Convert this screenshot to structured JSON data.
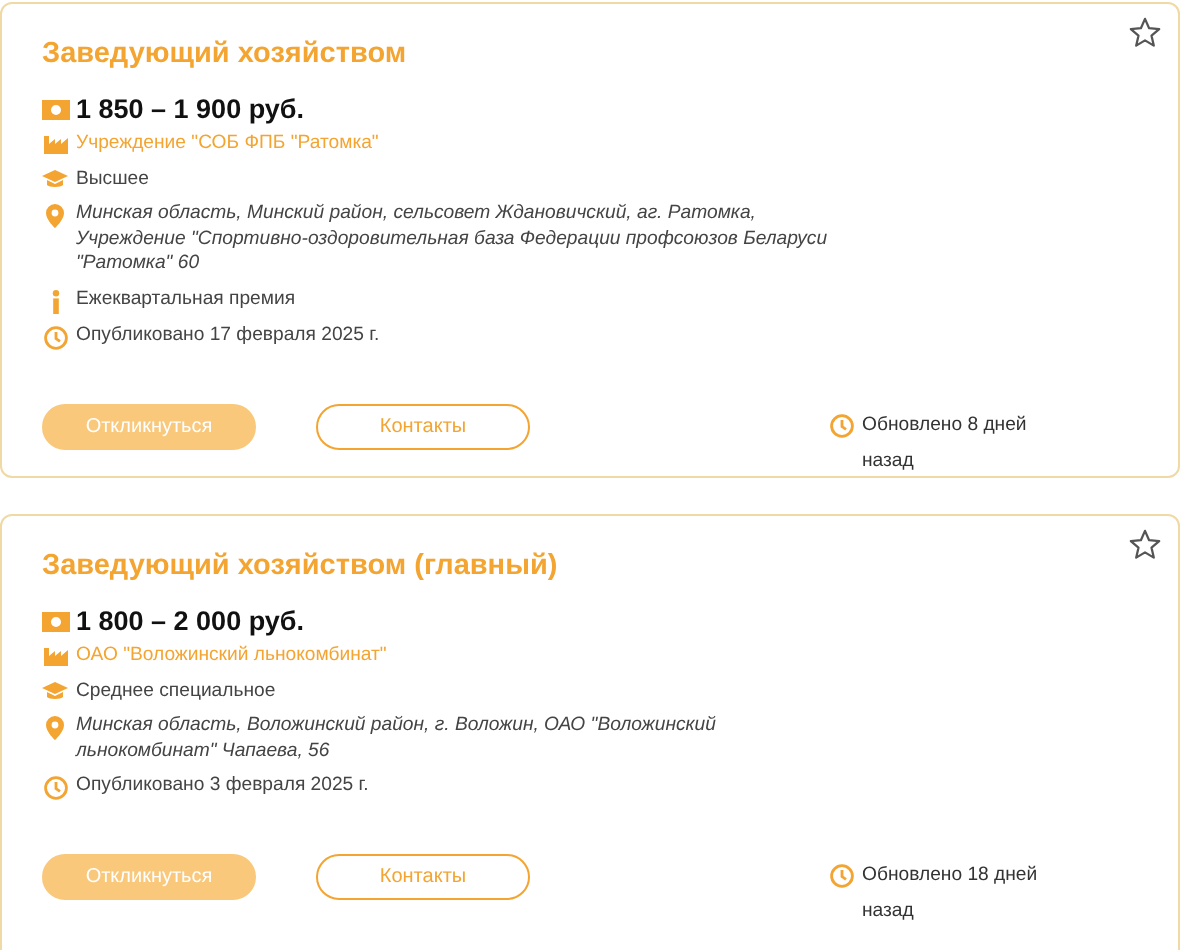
{
  "vacancies": [
    {
      "title": "Заведующий хозяйством",
      "favorite": false,
      "salary": "1 850 – 1 900 руб.",
      "details": [
        {
          "kind": "employer",
          "text": "Учреждение \"СОБ ФПБ \"Ратомка\""
        },
        {
          "kind": "education",
          "text": "Высшее"
        },
        {
          "kind": "address",
          "text": "Минская область, Минский район, сельсовет Ждановичский, аг. Ратомка, Учреждение \"Спортивно-оздоровительная база Федерации профсоюзов Беларуси \"Ратомка\" 60"
        },
        {
          "kind": "bonus",
          "text": "Ежеквартальная премия"
        },
        {
          "kind": "published",
          "text": "Опубликовано 17 февраля 2025 г."
        }
      ],
      "buttons": [
        {
          "kind": "primary",
          "label": "Откликнуться"
        },
        {
          "kind": "outline",
          "label": "Контакты"
        }
      ],
      "updated": "Обновлено 8 дней назад"
    },
    {
      "title": "Заведующий хозяйством (главный)",
      "favorite": false,
      "salary": "1 800 – 2 000 руб.",
      "details": [
        {
          "kind": "employer",
          "text": "ОАО \"Воложинский льнокомбинат\""
        },
        {
          "kind": "education",
          "text": "Среднее специальное"
        },
        {
          "kind": "address",
          "text": "Минская область, Воложинский район, г. Воложин, ОАО \"Воложинский льнокомбинат\" Чапаева, 56"
        },
        {
          "kind": "published",
          "text": "Опубликовано 3 февраля 2025 г."
        }
      ],
      "buttons": [
        {
          "kind": "primary",
          "label": "Откликнуться"
        },
        {
          "kind": "outline",
          "label": "Контакты"
        }
      ],
      "updated": "Обновлено 18 дней назад"
    }
  ]
}
